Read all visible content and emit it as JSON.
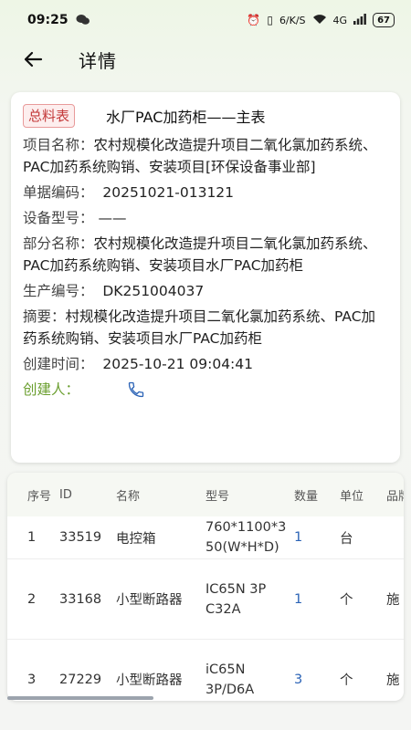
{
  "status": {
    "time": "09:25",
    "net_speed": "6/K/S",
    "signal": "4G",
    "battery": "67"
  },
  "header": {
    "title": "详情"
  },
  "detail": {
    "tag": "总料表",
    "title": "水厂PAC加药柜——主表",
    "fields": [
      {
        "label": "项目名称：",
        "value": "农村规模化改造提升项目二氧化氯加药系统、PAC加药系统购销、安装项目[环保设备事业部]"
      },
      {
        "label": "单据编码：",
        "value": "20251021-013121"
      },
      {
        "label": "设备型号：",
        "value": "——"
      },
      {
        "label": "部分名称：",
        "value": "农村规模化改造提升项目二氧化氯加药系统、PAC加药系统购销、安装项目水厂PAC加药柜"
      },
      {
        "label": "生产编号：",
        "value": "DK251004037"
      },
      {
        "label": "摘要：",
        "value": "村规模化改造提升项目二氧化氯加药系统、PAC加药系统购销、安装项目水厂PAC加药柜"
      },
      {
        "label": "创建时间：",
        "value": "2025-10-21 09:04:41"
      }
    ],
    "creator_label": "创建人："
  },
  "table": {
    "headers": [
      "序号",
      "ID",
      "名称",
      "型号",
      "数量",
      "单位",
      "品牌"
    ],
    "rows": [
      {
        "no": "1",
        "id": "33519",
        "name": "电控箱",
        "model": "760*1100*350(W*H*D)",
        "qty": "1",
        "unit": "台",
        "brand": ""
      },
      {
        "no": "2",
        "id": "33168",
        "name": "小型断路器",
        "model": "IC65N 3P C32A",
        "qty": "1",
        "unit": "个",
        "brand": "施"
      },
      {
        "no": "3",
        "id": "27229",
        "name": "小型断路器",
        "model": "iC65N 3P/D6A",
        "qty": "3",
        "unit": "个",
        "brand": "施"
      }
    ]
  }
}
